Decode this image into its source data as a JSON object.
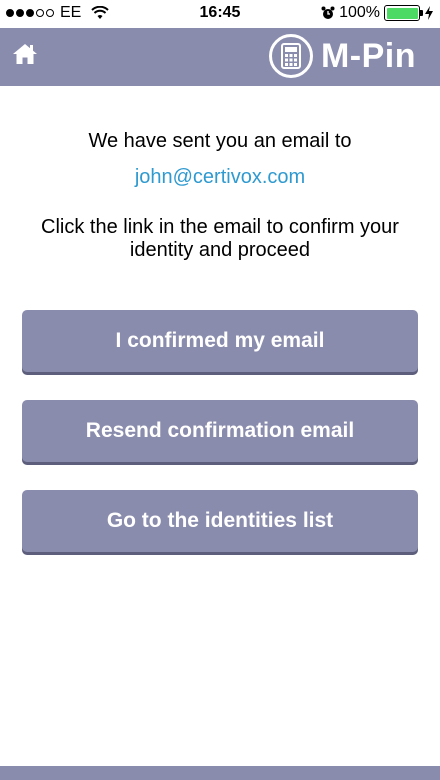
{
  "status_bar": {
    "carrier": "EE",
    "time": "16:45",
    "battery": "100%"
  },
  "header": {
    "logo_text": "M-Pin"
  },
  "main": {
    "line1": "We have sent you an email to",
    "email": "john@certivox.com",
    "line2": "Click the link in the email to confirm your",
    "line3": "identity and proceed",
    "buttons": {
      "confirmed": "I confirmed my email",
      "resend": "Resend confirmation email",
      "identities": "Go to the identities list"
    }
  },
  "colors": {
    "accent": "#8a8cad",
    "link": "#2f9ad0",
    "battery": "#4cd964"
  }
}
